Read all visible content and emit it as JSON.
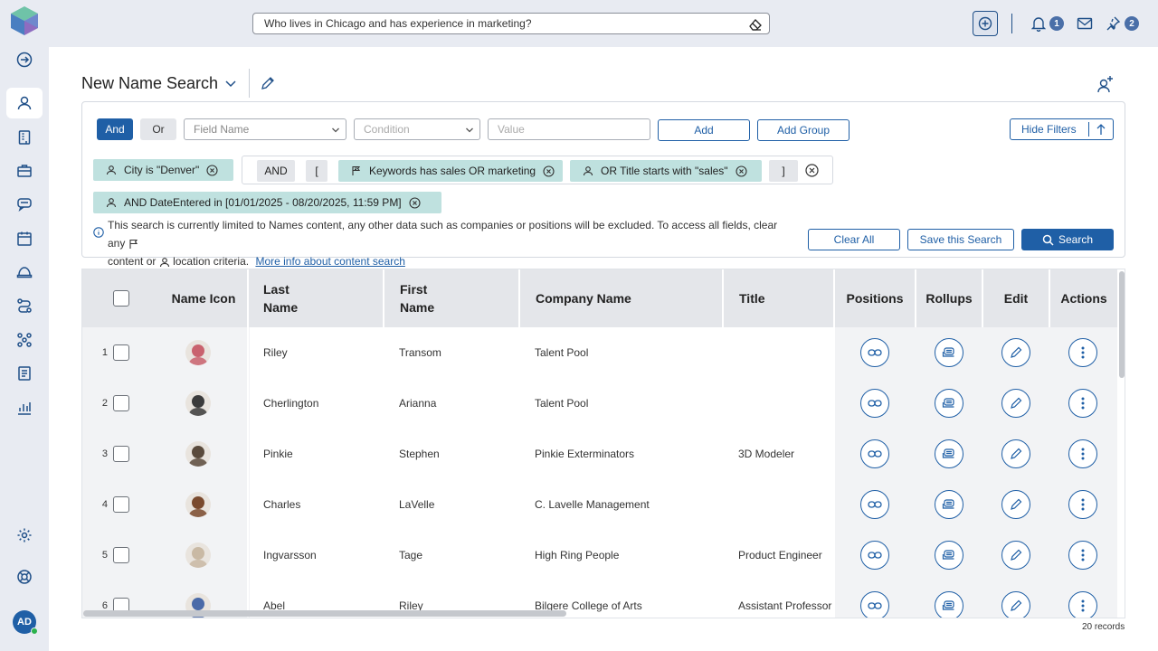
{
  "app": {
    "logo_icon": "cube-logo-icon",
    "rail": [
      {
        "id": "expand",
        "icon": "arrow-circle-right-icon"
      },
      {
        "id": "names",
        "icon": "person-icon",
        "active": true
      },
      {
        "id": "companies",
        "icon": "building-icon"
      },
      {
        "id": "positions",
        "icon": "briefcase-icon"
      },
      {
        "id": "activities",
        "icon": "chat-icon"
      },
      {
        "id": "calendar",
        "icon": "calendar-icon"
      },
      {
        "id": "talent",
        "icon": "hat-icon"
      },
      {
        "id": "pipelines",
        "icon": "pipeline-icon"
      },
      {
        "id": "apps",
        "icon": "apps-icon"
      },
      {
        "id": "documents",
        "icon": "document-icon"
      },
      {
        "id": "reports",
        "icon": "bar-chart-icon"
      },
      {
        "id": "settings",
        "icon": "gear-icon"
      },
      {
        "id": "help",
        "icon": "lifebuoy-icon"
      }
    ],
    "user_initials": "AD"
  },
  "topbar": {
    "search_value": "Who lives in Chicago and has experience in marketing?",
    "notifications_count": "1",
    "pins_count": "2"
  },
  "page": {
    "title": "New Name Search"
  },
  "filters": {
    "and_label": "And",
    "or_label": "Or",
    "field_name_placeholder": "Field Name",
    "condition_placeholder": "Condition",
    "value_placeholder": "Value",
    "add_label": "Add",
    "add_group_label": "Add Group",
    "hide_filters_label": "Hide Filters",
    "chip_city": "City is \"Denver\"",
    "group_and": "AND",
    "group_open": "[",
    "chip_keywords": "Keywords has sales OR marketing",
    "chip_title": "OR Title starts with \"sales\"",
    "group_close": "]",
    "chip_date": "AND DateEntered in [01/01/2025 - 08/20/2025, 11:59 PM]",
    "info_line1": "This search is currently limited to Names content, any other data such as companies or positions will be excluded. To access all fields, clear any",
    "info_line2_a": "content or",
    "info_line2_b": "location criteria.",
    "info_link": "More info about content search",
    "clear_all_label": "Clear All",
    "save_label": "Save this Search",
    "search_label": "Search"
  },
  "table": {
    "headers": {
      "name_icon": "Name Icon",
      "last_name_1": "Last",
      "last_name_2": "Name",
      "first_name_1": "First",
      "first_name_2": "Name",
      "company": "Company Name",
      "title": "Title",
      "positions": "Positions",
      "rollups": "Rollups",
      "edit": "Edit",
      "actions": "Actions"
    },
    "rows": [
      {
        "num": "1",
        "last": "Riley",
        "first": "Transom",
        "company": "Talent Pool",
        "title": "",
        "avatar_color": "#c9626e"
      },
      {
        "num": "2",
        "last": "Cherlington",
        "first": "Arianna",
        "company": "Talent Pool",
        "title": "",
        "avatar_color": "#3b3b3b"
      },
      {
        "num": "3",
        "last": "Pinkie",
        "first": "Stephen",
        "company": "Pinkie Exterminators",
        "title": "3D Modeler",
        "avatar_color": "#5a4a3c"
      },
      {
        "num": "4",
        "last": "Charles",
        "first": "LaVelle",
        "company": "C. Lavelle Management",
        "title": "",
        "avatar_color": "#7a4a2e"
      },
      {
        "num": "5",
        "last": "Ingvarsson",
        "first": "Tage",
        "company": "High Ring People",
        "title": "Product Engineer",
        "avatar_color": "#c9b9a4"
      },
      {
        "num": "6",
        "last": "Abel",
        "first": "Riley",
        "company": "Bilgere College of Arts",
        "title": "Assistant Professor",
        "avatar_color": "#4a6aa8"
      }
    ],
    "records_label": "20 records"
  }
}
